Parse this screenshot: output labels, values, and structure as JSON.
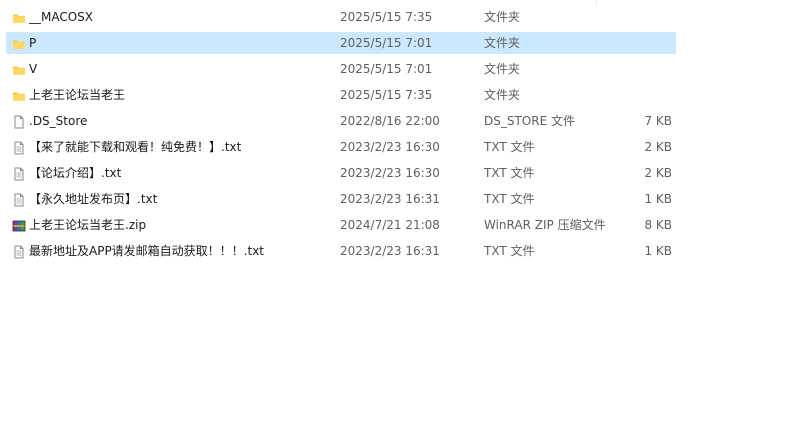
{
  "files": [
    {
      "name": "__MACOSX",
      "date": "2025/5/15 7:35",
      "type": "文件夹",
      "size": "",
      "icon": "folder-icon",
      "selected": false
    },
    {
      "name": "P",
      "date": "2025/5/15 7:01",
      "type": "文件夹",
      "size": "",
      "icon": "folder-icon",
      "selected": true
    },
    {
      "name": "V",
      "date": "2025/5/15 7:01",
      "type": "文件夹",
      "size": "",
      "icon": "folder-icon",
      "selected": false
    },
    {
      "name": "上老王论坛当老王",
      "date": "2025/5/15 7:35",
      "type": "文件夹",
      "size": "",
      "icon": "folder-icon",
      "selected": false
    },
    {
      "name": ".DS_Store",
      "date": "2022/8/16 22:00",
      "type": "DS_STORE 文件",
      "size": "7 KB",
      "icon": "blank-file-icon",
      "selected": false
    },
    {
      "name": "【来了就能下载和观看！纯免费！】.txt",
      "date": "2023/2/23 16:30",
      "type": "TXT 文件",
      "size": "2 KB",
      "icon": "text-file-icon",
      "selected": false
    },
    {
      "name": "【论坛介绍】.txt",
      "date": "2023/2/23 16:30",
      "type": "TXT 文件",
      "size": "2 KB",
      "icon": "text-file-icon",
      "selected": false
    },
    {
      "name": "【永久地址发布页】.txt",
      "date": "2023/2/23 16:31",
      "type": "TXT 文件",
      "size": "1 KB",
      "icon": "text-file-icon",
      "selected": false
    },
    {
      "name": "上老王论坛当老王.zip",
      "date": "2024/7/21 21:08",
      "type": "WinRAR ZIP 压缩文件",
      "size": "8 KB",
      "icon": "winrar-archive-icon",
      "selected": false
    },
    {
      "name": "最新地址及APP请发邮箱自动获取！！！.txt",
      "date": "2023/2/23 16:31",
      "type": "TXT 文件",
      "size": "1 KB",
      "icon": "text-file-icon",
      "selected": false
    }
  ],
  "colors": {
    "selection": "#cce8ff",
    "folder": "#f8c646",
    "text": "#1b1b1b",
    "meta_text": "#5f5f5f"
  }
}
